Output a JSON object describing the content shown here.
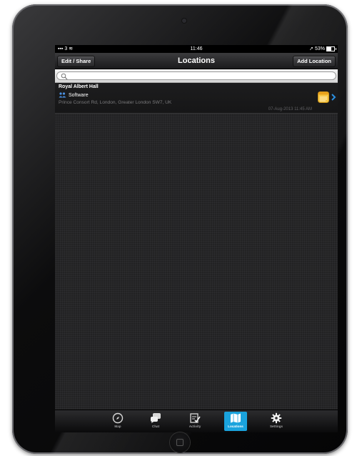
{
  "status_bar": {
    "carrier": "3",
    "time": "11:46",
    "battery": "53%"
  },
  "nav": {
    "title": "Locations",
    "left_button": "Edit / Share",
    "right_button": "Add Location"
  },
  "search": {
    "placeholder": ""
  },
  "locations": [
    {
      "name": "Royal Albert Hall",
      "category": "Software",
      "address": "Prince Consort Rd, London, Greater London SW7, UK",
      "timestamp": "07-Aug-2013 11:45 AM"
    }
  ],
  "tabs": [
    {
      "label": "Map",
      "icon": "compass-icon",
      "active": false
    },
    {
      "label": "Chat",
      "icon": "chat-bubble-icon",
      "active": false
    },
    {
      "label": "Activity",
      "icon": "activity-checklist-icon",
      "active": false
    },
    {
      "label": "Locations",
      "icon": "map-icon",
      "active": true
    },
    {
      "label": "Settings",
      "icon": "gear-icon",
      "active": false
    }
  ],
  "colors": {
    "accent": "#1aa3dd",
    "background": "#222223"
  }
}
